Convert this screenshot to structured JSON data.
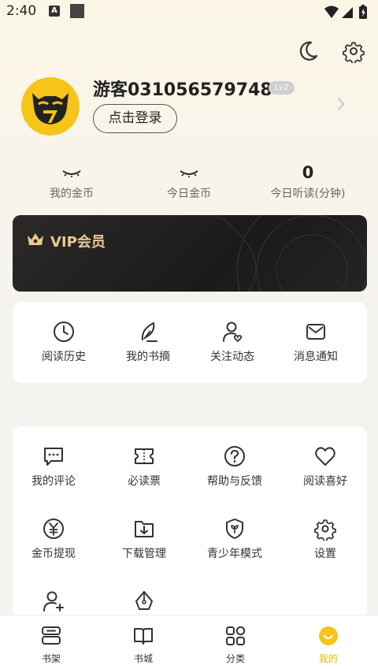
{
  "status_bar": {
    "time": "2:40",
    "notif_icon": "A"
  },
  "header": {
    "night_mode_icon": "moon-icon",
    "settings_icon": "gear-icon"
  },
  "profile": {
    "username": "游客031056579748",
    "level": "Lv2",
    "login_button": "点击登录"
  },
  "stats": [
    {
      "value": "",
      "label": "我的金币"
    },
    {
      "value": "",
      "label": "今日金币"
    },
    {
      "value": "0",
      "label": "今日听读(分钟)"
    }
  ],
  "vip": {
    "label": "VIP会员",
    "accent": "#e9c98d"
  },
  "quick_actions": [
    {
      "label": "阅读历史",
      "icon": "clock-icon"
    },
    {
      "label": "我的书摘",
      "icon": "feather-icon"
    },
    {
      "label": "关注动态",
      "icon": "user-heart-icon"
    },
    {
      "label": "消息通知",
      "icon": "mail-icon"
    }
  ],
  "services": [
    {
      "label": "我的评论",
      "icon": "comment-icon"
    },
    {
      "label": "必读票",
      "icon": "ticket-icon"
    },
    {
      "label": "帮助与反馈",
      "icon": "help-icon"
    },
    {
      "label": "阅读喜好",
      "icon": "heart-icon"
    },
    {
      "label": "金币提现",
      "icon": "yuan-icon"
    },
    {
      "label": "下载管理",
      "icon": "download-folder-icon"
    },
    {
      "label": "青少年模式",
      "icon": "shield-sprout-icon"
    },
    {
      "label": "设置",
      "icon": "gear-icon"
    },
    {
      "label": "",
      "icon": "add-user-icon"
    },
    {
      "label": "",
      "icon": "pen-nib-icon"
    }
  ],
  "tabs": [
    {
      "label": "书架",
      "icon": "bookshelf-icon"
    },
    {
      "label": "书城",
      "icon": "book-open-icon"
    },
    {
      "label": "分类",
      "icon": "grid-icon"
    },
    {
      "label": "我的",
      "icon": "profile-smile-icon",
      "active": true
    }
  ],
  "colors": {
    "accent": "#f0b400",
    "avatar_bg": "#f7c41a",
    "vip_bg": "#1f1e1c"
  }
}
